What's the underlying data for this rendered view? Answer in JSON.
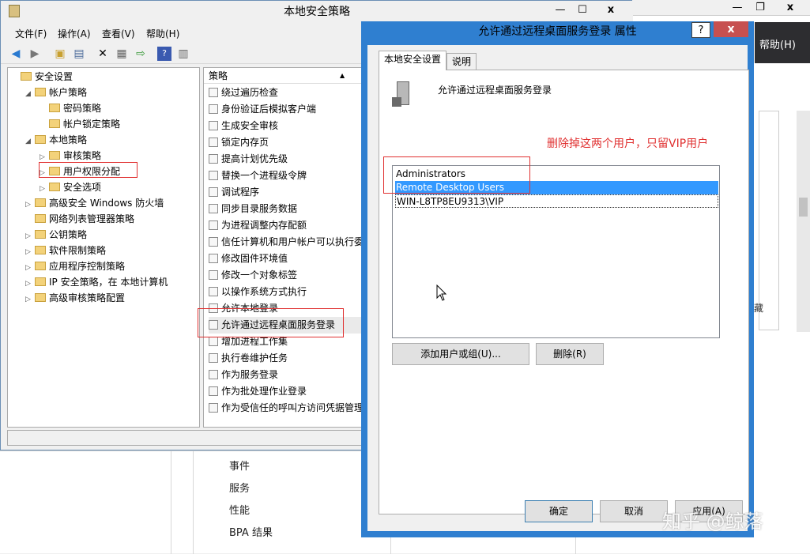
{
  "bg": {
    "help_label": "帮助(H)",
    "bottom_items": [
      "事件",
      "服务",
      "性能",
      "BPA 结果"
    ],
    "side_fragment": "藏"
  },
  "mmc": {
    "title": "本地安全策略",
    "menu": [
      "文件(F)",
      "操作(A)",
      "查看(V)",
      "帮助(H)"
    ],
    "tree": [
      {
        "label": "安全设置",
        "indent": 0,
        "exp": ""
      },
      {
        "label": "帐户策略",
        "indent": 1,
        "exp": "◢"
      },
      {
        "label": "密码策略",
        "indent": 2,
        "exp": ""
      },
      {
        "label": "帐户锁定策略",
        "indent": 2,
        "exp": ""
      },
      {
        "label": "本地策略",
        "indent": 1,
        "exp": "◢"
      },
      {
        "label": "审核策略",
        "indent": 2,
        "exp": "▷"
      },
      {
        "label": "用户权限分配",
        "indent": 2,
        "exp": "▷"
      },
      {
        "label": "安全选项",
        "indent": 2,
        "exp": "▷"
      },
      {
        "label": "高级安全 Windows 防火墙",
        "indent": 1,
        "exp": "▷"
      },
      {
        "label": "网络列表管理器策略",
        "indent": 1,
        "exp": ""
      },
      {
        "label": "公钥策略",
        "indent": 1,
        "exp": "▷"
      },
      {
        "label": "软件限制策略",
        "indent": 1,
        "exp": "▷"
      },
      {
        "label": "应用程序控制策略",
        "indent": 1,
        "exp": "▷"
      },
      {
        "label": "IP 安全策略，在 本地计算机",
        "indent": 1,
        "exp": "▷"
      },
      {
        "label": "高级审核策略配置",
        "indent": 1,
        "exp": "▷"
      }
    ],
    "policy_header": "策略",
    "policies": [
      "绕过遍历检查",
      "身份验证后模拟客户端",
      "生成安全审核",
      "锁定内存页",
      "提高计划优先级",
      "替换一个进程级令牌",
      "调试程序",
      "同步目录服务数据",
      "为进程调整内存配额",
      "信任计算机和用户帐户可以执行委",
      "修改固件环境值",
      "修改一个对象标签",
      "以操作系统方式执行",
      "允许本地登录",
      "允许通过远程桌面服务登录",
      "增加进程工作集",
      "执行卷维护任务",
      "作为服务登录",
      "作为批处理作业登录",
      "作为受信任的呼叫方访问凭据管理"
    ]
  },
  "dialog": {
    "title": "允许通过远程桌面服务登录 属性",
    "help_btn": "?",
    "close_btn": "x",
    "tabs": [
      "本地安全设置",
      "说明"
    ],
    "policy_name": "允许通过远程桌面服务登录",
    "list": [
      "Administrators",
      "Remote Desktop Users",
      "WIN-L8TP8EU9313\\VIP"
    ],
    "selected_index": 1,
    "add_button": "添加用户或组(U)...",
    "remove_button": "删除(R)",
    "ok_button": "确定",
    "cancel_button": "取消",
    "apply_button": "应用(A)"
  },
  "annotation": "删除掉这两个用户，只留VIP用户",
  "watermark": "知乎 @鲸落",
  "colors": {
    "accent": "#2f7fd0",
    "selected": "#3399ff",
    "annotation": "#e03030"
  }
}
